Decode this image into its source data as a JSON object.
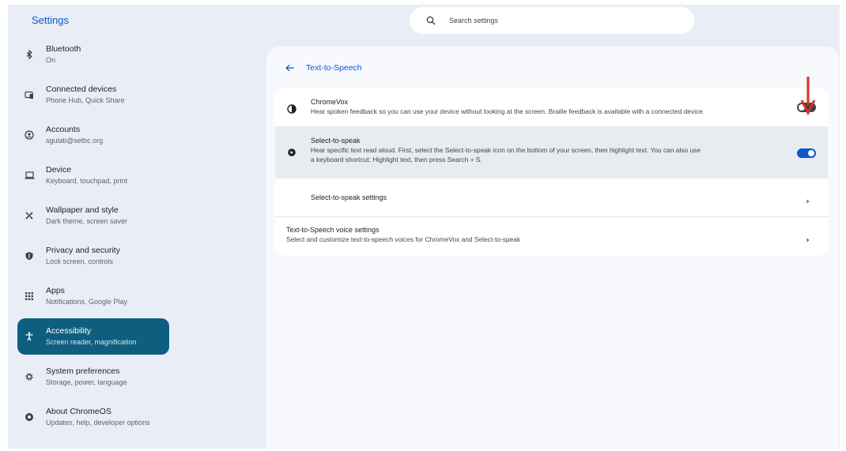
{
  "app": {
    "title": "Settings"
  },
  "search": {
    "placeholder": "Search settings"
  },
  "sidebar": {
    "items": [
      {
        "label": "Bluetooth",
        "sub": "On",
        "icon": "bluetooth-icon"
      },
      {
        "label": "Connected devices",
        "sub": "Phone Hub, Quick Share",
        "icon": "connected-devices-icon"
      },
      {
        "label": "Accounts",
        "sub": "sgulati@setbc.org",
        "icon": "account-icon"
      },
      {
        "label": "Device",
        "sub": "Keyboard, touchpad, print",
        "icon": "laptop-icon"
      },
      {
        "label": "Wallpaper and style",
        "sub": "Dark theme, screen saver",
        "icon": "palette-icon"
      },
      {
        "label": "Privacy and security",
        "sub": "Lock screen, controls",
        "icon": "shield-icon"
      },
      {
        "label": "Apps",
        "sub": "Notifications, Google Play",
        "icon": "apps-grid-icon"
      },
      {
        "label": "Accessibility",
        "sub": "Screen reader, magnification",
        "icon": "accessibility-icon",
        "active": true
      },
      {
        "label": "System preferences",
        "sub": "Storage, power, language",
        "icon": "gear-icon"
      },
      {
        "label": "About ChromeOS",
        "sub": "Updates, help, developer options",
        "icon": "chrome-icon"
      }
    ]
  },
  "page": {
    "title": "Text-to-Speech"
  },
  "settings": {
    "chromevox": {
      "title": "ChromeVox",
      "desc": "Hear spoken feedback so you can use your device without looking at the screen. Braille feedback is available with a connected device.",
      "enabled": false
    },
    "select_to_speak": {
      "title": "Select-to-speak",
      "desc_line1": "Hear specific text read aloud. First, select the Select-to-speak icon on the bottom of your screen, then highlight text. You can also use",
      "desc_line2": "a keyboard shortcut: Highlight text, then press Search + S.",
      "enabled": true
    },
    "select_to_speak_settings": {
      "title": "Select-to-speak settings"
    },
    "voice_settings": {
      "title": "Text-to-Speech voice settings",
      "desc": "Select and customize text-to-speech voices for ChromeVox and Select-to-speak"
    }
  },
  "colors": {
    "accent": "#0b57d0",
    "active_nav": "#0e5f7f",
    "toggle_on": "#0b57d0",
    "annotation_arrow": "#d93025"
  }
}
